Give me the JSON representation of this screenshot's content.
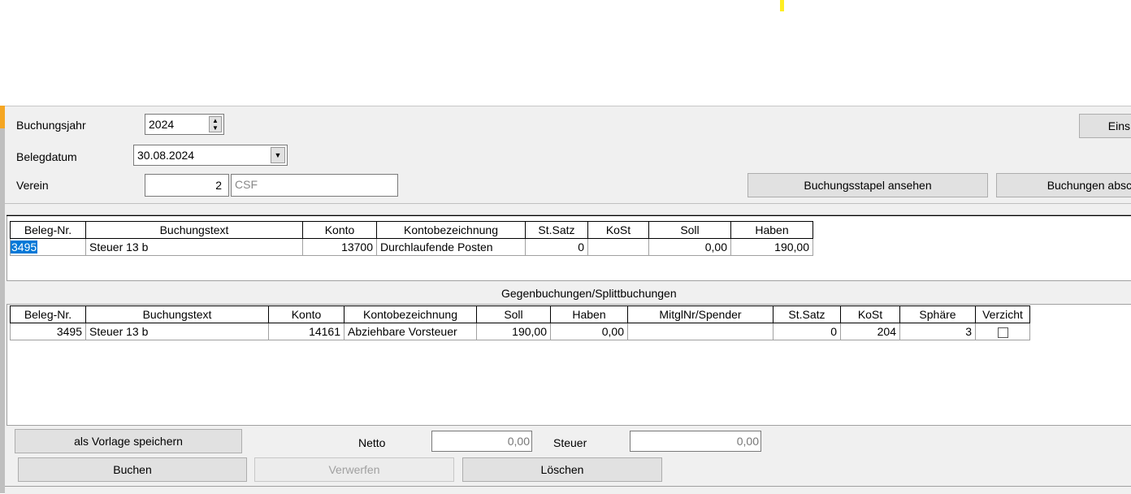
{
  "form": {
    "buchungsjahr_label": "Buchungsjahr",
    "buchungsjahr_value": "2024",
    "belegdatum_label": "Belegdatum",
    "belegdatum_value": "30.08.2024",
    "verein_label": "Verein",
    "verein_number": "2",
    "verein_name": "CSF",
    "eins_button": "Eins",
    "stapel_button": "Buchungsstapel ansehen",
    "abschliessen_button": "Buchungen absc"
  },
  "main_table": {
    "headers": [
      "Beleg-Nr.",
      "Buchungstext",
      "Konto",
      "Kontobezeichnung",
      "St.Satz",
      "KoSt",
      "Soll",
      "Haben"
    ],
    "row": {
      "beleg_nr": "3495",
      "buchungstext": "Steuer 13 b",
      "konto": "13700",
      "kontobezeichnung": "Durchlaufende Posten",
      "st_satz": "0",
      "kost": "",
      "soll": "0,00",
      "haben": "190,00"
    }
  },
  "split_table": {
    "title": "Gegenbuchungen/Splittbuchungen",
    "headers": [
      "Beleg-Nr.",
      "Buchungstext",
      "Konto",
      "Kontobezeichnung",
      "Soll",
      "Haben",
      "MitglNr/Spender",
      "St.Satz",
      "KoSt",
      "Sphäre",
      "Verzicht"
    ],
    "row": {
      "beleg_nr": "3495",
      "buchungstext": "Steuer 13 b",
      "konto": "14161",
      "kontobezeichnung": "Abziehbare Vorsteuer",
      "soll": "190,00",
      "haben": "0,00",
      "mitglnr": "",
      "st_satz": "0",
      "kost": "204",
      "sphaere": "3"
    }
  },
  "footer": {
    "vorlage_button": "als Vorlage speichern",
    "netto_label": "Netto",
    "netto_value": "0,00",
    "steuer_label": "Steuer",
    "steuer_value": "0,00",
    "buchen_button": "Buchen",
    "verwerfen_button": "Verwerfen",
    "loeschen_button": "Löschen"
  },
  "colors": {
    "highlight": "#ffee22",
    "selection": "#0078d7",
    "window": "#f0f0f0"
  }
}
